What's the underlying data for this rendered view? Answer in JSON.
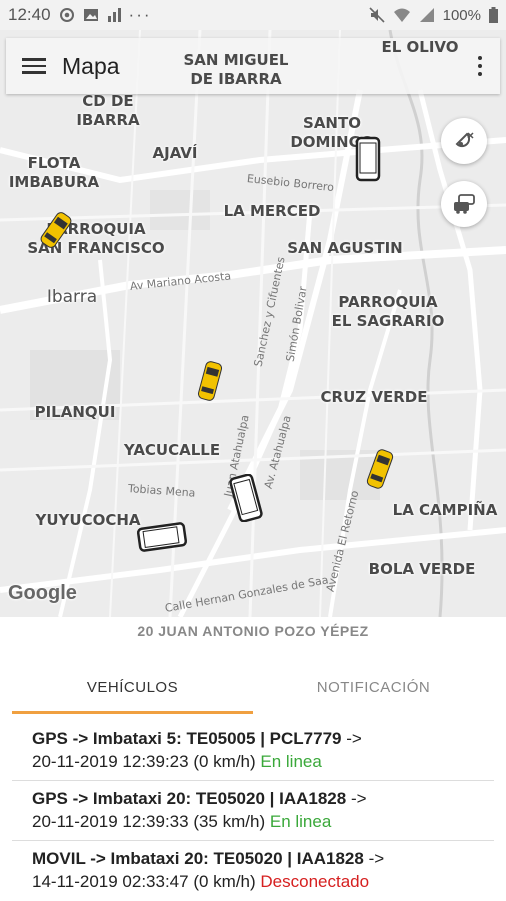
{
  "status_bar": {
    "time": "12:40",
    "battery": "100%",
    "left_icons": [
      "at-sign-icon",
      "image-icon",
      "signal-bars-icon",
      "more-dots-icon"
    ],
    "right_icons": [
      "mute-icon",
      "wifi-icon",
      "cell-signal-icon",
      "battery-icon"
    ]
  },
  "app_bar": {
    "title": "Mapa",
    "menu_icon": "hamburger-menu-icon",
    "overflow_icon": "more-vert-icon"
  },
  "map": {
    "labels": {
      "san_miguel": "SAN MIGUEL\nDE IBARRA",
      "el_olivo": "EL OLIVO",
      "cd_ibarra": "CD DE\nIBARRA",
      "santo_domingo": "SANTO\nDOMINGO",
      "ajavi": "AJAVÍ",
      "flota": "FLOTA\nIMBABURA",
      "la_merced": "LA MERCED",
      "parroquia_sf": "PARROQUIA\nSAN FRANCISCO",
      "san_agustin": "SAN AGUSTIN",
      "ibarra": "Ibarra",
      "sagrario": "PARROQUIA\nEL SAGRARIO",
      "pilanqui": "PILANQUI",
      "cruz_verde": "CRUZ VERDE",
      "yacucalle": "YACUCALLE",
      "yuyucocha": "YUYUCOCHA",
      "la_campina": "LA CAMPIÑA",
      "bola_verde": "BOLA VERDE"
    },
    "streets": {
      "eusebio": "Eusebio Borrero",
      "mariano": "Av Mariano Acosta",
      "sanchez": "Sanchez y Cifuentes",
      "bolivar": "Simón Bolivar",
      "atahualpa1": "Juan Atahualpa",
      "atahualpa2": "Av. Atahualpa",
      "tobias": "Tobias Mena",
      "retorno": "Avenida El Retorno",
      "hernan": "Calle Hernan Gonzales de Saa"
    },
    "google_logo": "Google",
    "buttons": [
      "satellite-off-icon",
      "traffic-cars-icon"
    ]
  },
  "driver_name": "20 JUAN ANTONIO POZO YÉPEZ",
  "tabs": [
    {
      "label": "VEHÍCULOS",
      "active": true
    },
    {
      "label": "NOTIFICACIÓN",
      "active": false
    }
  ],
  "vehicles": [
    {
      "line1": "GPS -> Imbataxi 5: TE05005 | PCL7779",
      "arrow": " ->",
      "line2": "20-11-2019 12:39:23 (0 km/h)",
      "status": "En linea",
      "status_color": "#3aa83a"
    },
    {
      "line1": "GPS -> Imbataxi 20: TE05020 | IAA1828",
      "arrow": " ->",
      "line2": "20-11-2019 12:39:33 (35 km/h)",
      "status": "En linea",
      "status_color": "#3aa83a"
    },
    {
      "line1": "MOVIL -> Imbataxi 20: TE05020 | IAA1828",
      "arrow": " ->",
      "line2": "14-11-2019 02:33:47 (0 km/h)",
      "status": "Desconectado",
      "status_color": "#d62020"
    }
  ],
  "colors": {
    "taxi": "#f2c200",
    "tab_indicator": "#f0a040",
    "online": "#3aa83a",
    "offline": "#d62020"
  }
}
